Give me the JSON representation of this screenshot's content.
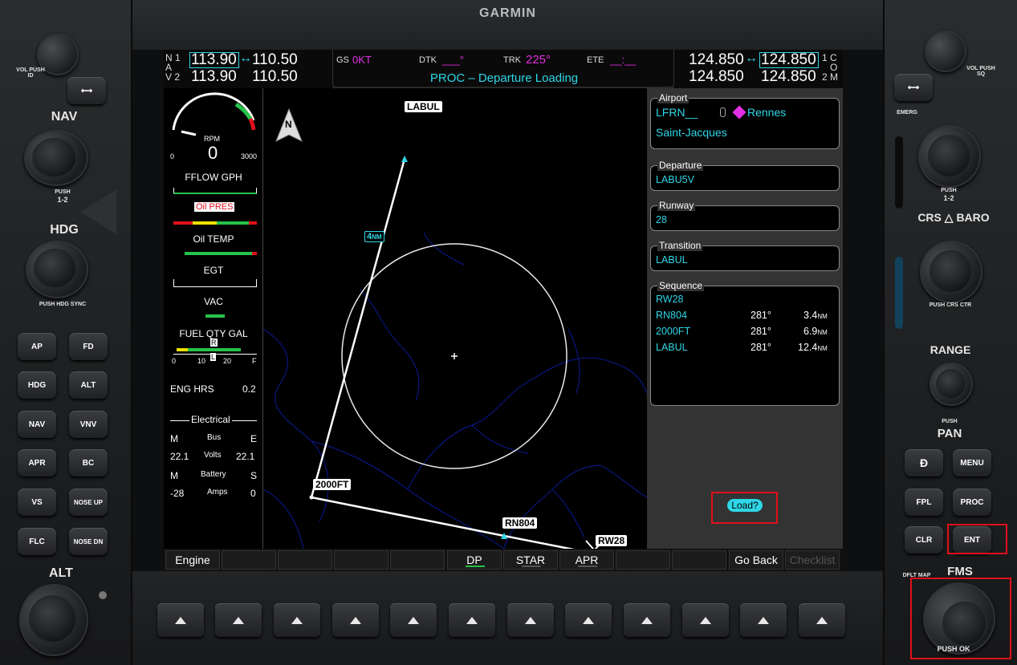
{
  "brand": "GARMIN",
  "left_bezel": {
    "vol_label": "VOL",
    "vol_push": "PUSH ID",
    "swap_arrow": "⟷",
    "nav": "NAV",
    "nav_push": "PUSH",
    "nav_12": "1-2",
    "hdg": "HDG",
    "hdg_push": "PUSH HDG SYNC",
    "alt": "ALT",
    "buttons": [
      {
        "l": "AP"
      },
      {
        "l": "FD"
      },
      {
        "l": "HDG"
      },
      {
        "l": "ALT"
      },
      {
        "l": "NAV"
      },
      {
        "l": "VNV"
      },
      {
        "l": "APR"
      },
      {
        "l": "BC"
      },
      {
        "l": "VS"
      },
      {
        "l": "NOSE UP"
      },
      {
        "l": "FLC"
      },
      {
        "l": "NOSE DN"
      }
    ]
  },
  "right_bezel": {
    "vol_label": "VOL",
    "vol_push": "PUSH SQ",
    "emerg": "EMERG",
    "push": "PUSH",
    "com_12": "1-2",
    "crs_baro": "CRS",
    "baro": "BARO",
    "crs_push": "PUSH CRS CTR",
    "range": "RANGE",
    "pan_push": "PUSH",
    "pan": "PAN",
    "dflt_map": "DFLT MAP",
    "fms": "FMS",
    "push_ok": "PUSH OK",
    "buttons": [
      {
        "l": "Ð"
      },
      {
        "l": "MENU"
      },
      {
        "l": "FPL"
      },
      {
        "l": "PROC"
      },
      {
        "l": "CLR"
      },
      {
        "l": "ENT"
      }
    ]
  },
  "topbar": {
    "nav1_label": "N 1",
    "nav1_active": "113.90",
    "nav1_standby": "110.50",
    "nav2_label": "V 2",
    "nav2_active": "113.90",
    "nav2_standby": "110.50",
    "nav_a": "A",
    "swap": "↔",
    "gs_label": "GS",
    "gs_value": "0KT",
    "dtk_label": "DTK",
    "dtk_value": "___°",
    "trk_label": "TRK",
    "trk_value": "225°",
    "ete_label": "ETE",
    "ete_value": "__:__",
    "page_title": "PROC – Departure Loading",
    "com1_active": "124.850",
    "com1_standby": "124.850",
    "com1_label": "1 C",
    "com2_active": "124.850",
    "com2_standby": "124.850",
    "com2_label": "2 M",
    "com_o": "O"
  },
  "eis": {
    "rpm_label": "RPM",
    "rpm_value": "0",
    "rpm_min": "0",
    "rpm_max": "3000",
    "fflow": "FFLOW GPH",
    "oil_pres": "Oil PRES",
    "oil_temp": "Oil TEMP",
    "egt": "EGT",
    "vac": "VAC",
    "fuel_qty": "FUEL QTY GAL",
    "fuel_ticks": [
      "0",
      "10",
      "20",
      "F"
    ],
    "fuel_marker_l": "L",
    "fuel_marker_r": "R",
    "eng_hrs_label": "ENG HRS",
    "eng_hrs_value": "0.2",
    "electrical": "Electrical",
    "m1": "M",
    "bus": "Bus",
    "e1": "E",
    "bus_m": "22.1",
    "volts": "Volts",
    "bus_e": "22.1",
    "m2": "M",
    "battery": "Battery",
    "s1": "S",
    "amps_m": "-28",
    "amps": "Amps",
    "amps_s": "0"
  },
  "map": {
    "north": "N",
    "waypoints": [
      {
        "name": "LABUL"
      },
      {
        "name": "2000FT"
      },
      {
        "name": "RN804"
      },
      {
        "name": "RW28"
      }
    ],
    "range_label": "4",
    "range_unit": "NM"
  },
  "panel": {
    "airport_title": "Airport",
    "airport_ident": "LFRN__",
    "airport_city": "Rennes",
    "airport_name": "Saint-Jacques",
    "departure_title": "Departure",
    "departure_value": "LABU5V",
    "runway_title": "Runway",
    "runway_value": "28",
    "transition_title": "Transition",
    "transition_value": "LABUL",
    "sequence_title": "Sequence",
    "sequence": [
      {
        "wpt": "RW28",
        "crs": "",
        "dist": "",
        "unit": ""
      },
      {
        "wpt": "RN804",
        "crs": "281°",
        "dist": "3.4",
        "unit": "NM"
      },
      {
        "wpt": "2000FT",
        "crs": "281°",
        "dist": "6.9",
        "unit": "NM"
      },
      {
        "wpt": "LABUL",
        "crs": "281°",
        "dist": "12.4",
        "unit": "NM"
      }
    ],
    "load_button": "Load?"
  },
  "softkeys": [
    {
      "label": "Engine"
    },
    {
      "label": ""
    },
    {
      "label": ""
    },
    {
      "label": ""
    },
    {
      "label": ""
    },
    {
      "label": "DP"
    },
    {
      "label": "STAR"
    },
    {
      "label": "APR"
    },
    {
      "label": ""
    },
    {
      "label": ""
    },
    {
      "label": "Go Back"
    },
    {
      "label": "Checklist"
    }
  ],
  "colors": {
    "cyan": "#2fd6e6",
    "magenta": "#e32fe3",
    "green": "#26c34a",
    "highlight": "#e0101b"
  }
}
